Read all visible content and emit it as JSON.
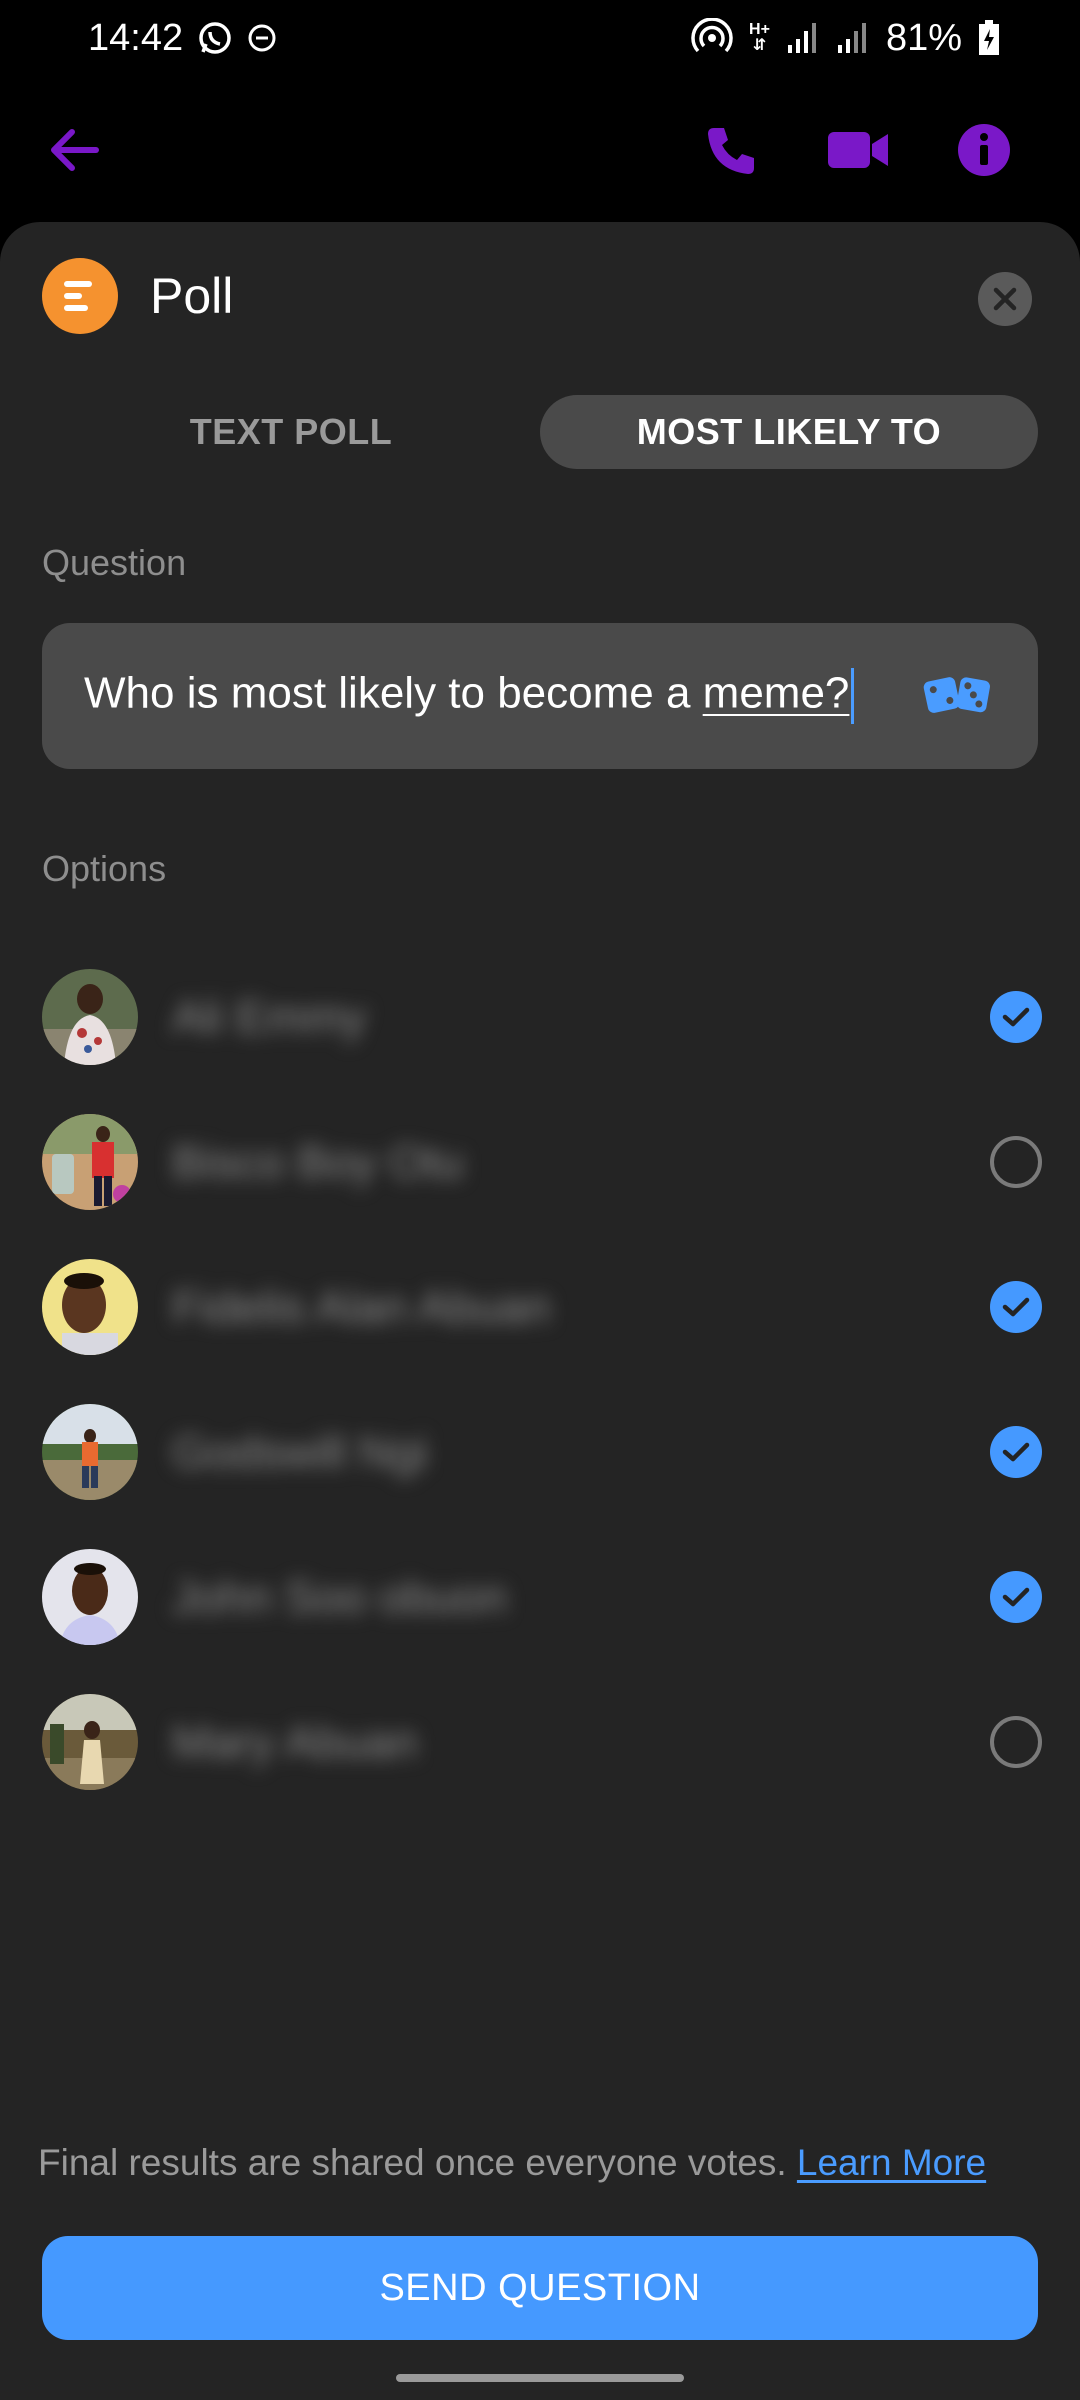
{
  "status_bar": {
    "time": "14:42",
    "battery": "81%",
    "network_label": "H+"
  },
  "nav": {
    "accent_color": "#7a18c8"
  },
  "poll": {
    "title": "Poll",
    "tabs": [
      {
        "label": "TEXT POLL",
        "active": false
      },
      {
        "label": "MOST LIKELY TO",
        "active": true
      }
    ],
    "question_label": "Question",
    "question_prefix": "Who is most likely to become a ",
    "question_underlined": "meme?",
    "options_label": "Options",
    "options": [
      {
        "name": "Ali Emmy",
        "checked": true
      },
      {
        "name": "Bisco Boy Otu",
        "checked": false
      },
      {
        "name": "Fidelis Alan Abuan",
        "checked": true
      },
      {
        "name": "Godswill Ngi",
        "checked": true
      },
      {
        "name": "John Soo obuon",
        "checked": true
      },
      {
        "name": "Mary Abuan",
        "checked": false
      }
    ],
    "footer_text": "Final results are shared once everyone votes. ",
    "footer_link": "Learn More",
    "send_button": "SEND QUESTION"
  },
  "colors": {
    "accent_blue": "#4599ff",
    "poll_logo": "#f5922f",
    "sheet_bg": "#242424"
  }
}
